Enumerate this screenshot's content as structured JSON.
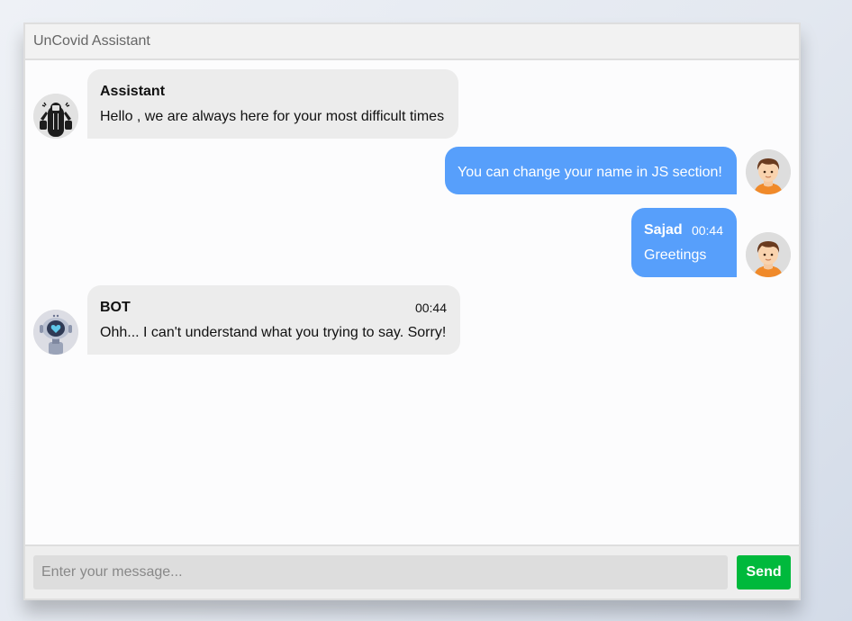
{
  "header": {
    "title": "UnCovid Assistant"
  },
  "messages": [
    {
      "side": "left",
      "name": "Assistant",
      "time": "",
      "text": "Hello , we are always here for your most difficult times",
      "avatar": "assistant-avatar-icon"
    },
    {
      "side": "right",
      "name": "",
      "time": "",
      "text": "You can change your name in JS section!",
      "avatar": "user-avatar-icon"
    },
    {
      "side": "right",
      "name": "Sajad",
      "time": "00:44",
      "text": "Greetings",
      "avatar": "user-avatar-icon"
    },
    {
      "side": "left",
      "name": "BOT",
      "time": "00:44",
      "text": "Ohh... I can't understand what you trying to say. Sorry!",
      "avatar": "robot-avatar-icon"
    }
  ],
  "input": {
    "placeholder": "Enter your message...",
    "value": ""
  },
  "send_button": {
    "label": "Send"
  },
  "colors": {
    "outgoing_bubble": "#579ffb",
    "incoming_bubble": "#ececec",
    "send_button": "#00b93c",
    "header_bg": "#f2f2f2"
  }
}
